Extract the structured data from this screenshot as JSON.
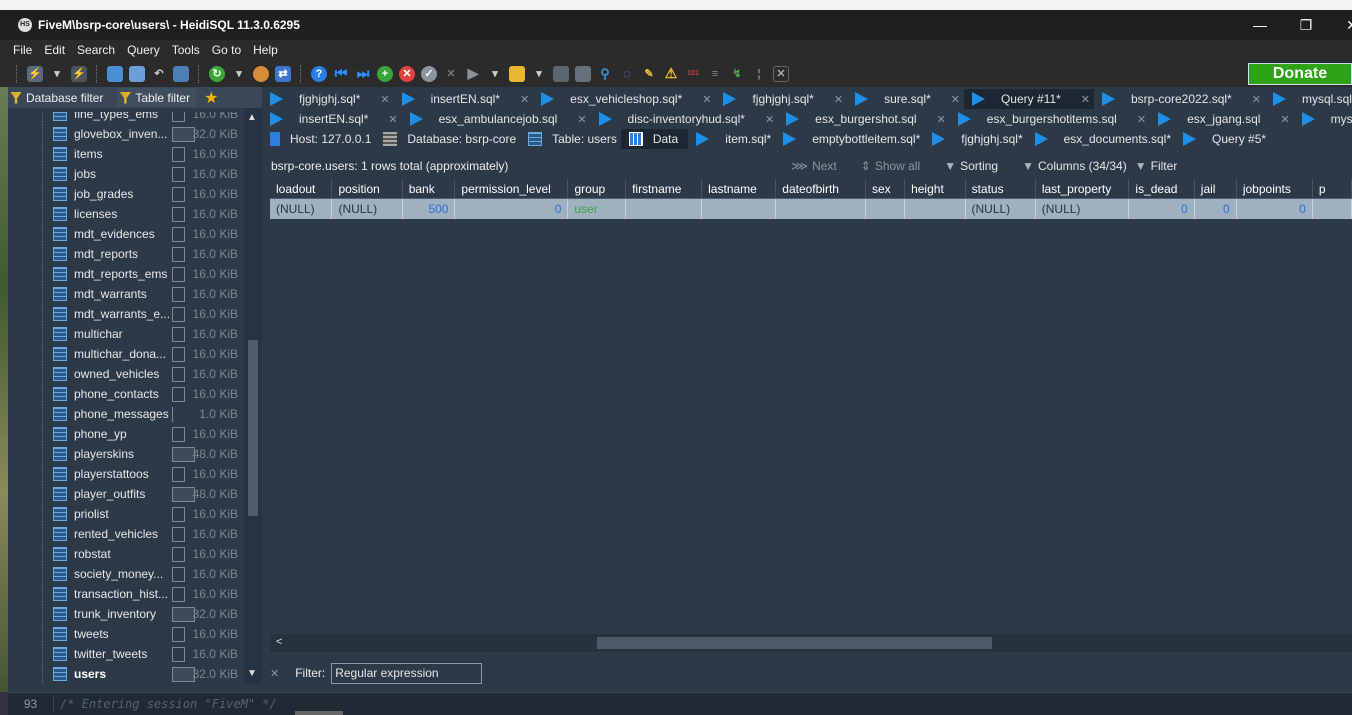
{
  "window": {
    "title": "FiveM\\bsrp-core\\users\\ - HeidiSQL 11.3.0.6295",
    "icon_label": "HS",
    "controls": [
      "—",
      "❐",
      "✕"
    ]
  },
  "menu": [
    "File",
    "Edit",
    "Search",
    "Query",
    "Tools",
    "Go to",
    "Help"
  ],
  "toolbar": {
    "donate_label": "Donate",
    "icons": [
      "connect-icon",
      "disconnect-icon",
      "copy-icon",
      "paste-icon",
      "undo-icon",
      "print-icon",
      "refresh-icon",
      "user-manager-icon",
      "sync-icon",
      "help-icon",
      "first-icon",
      "last-icon",
      "add-icon",
      "delete-icon",
      "ok-icon",
      "cancel-icon",
      "run-icon",
      "open-folder-icon",
      "save-icon",
      "save-as-icon",
      "find-icon",
      "replace-icon",
      "clean-icon",
      "warning-icon",
      "binary-icon",
      "wordwrap-icon",
      "format-icon",
      "close-icon"
    ]
  },
  "left_panel": {
    "database_filter_label": "Database filter",
    "table_filter_label": "Table filter",
    "tables": [
      {
        "name": "fine_types_ems",
        "size": "16.0 KiB",
        "bar": "normal"
      },
      {
        "name": "glovebox_inven...",
        "size": "32.0 KiB",
        "bar": "wide"
      },
      {
        "name": "items",
        "size": "16.0 KiB",
        "bar": "normal"
      },
      {
        "name": "jobs",
        "size": "16.0 KiB",
        "bar": "normal"
      },
      {
        "name": "job_grades",
        "size": "16.0 KiB",
        "bar": "normal"
      },
      {
        "name": "licenses",
        "size": "16.0 KiB",
        "bar": "normal"
      },
      {
        "name": "mdt_evidences",
        "size": "16.0 KiB",
        "bar": "normal"
      },
      {
        "name": "mdt_reports",
        "size": "16.0 KiB",
        "bar": "normal"
      },
      {
        "name": "mdt_reports_ems",
        "size": "16.0 KiB",
        "bar": "normal"
      },
      {
        "name": "mdt_warrants",
        "size": "16.0 KiB",
        "bar": "normal"
      },
      {
        "name": "mdt_warrants_e...",
        "size": "16.0 KiB",
        "bar": "normal"
      },
      {
        "name": "multichar",
        "size": "16.0 KiB",
        "bar": "normal"
      },
      {
        "name": "multichar_dona...",
        "size": "16.0 KiB",
        "bar": "normal"
      },
      {
        "name": "owned_vehicles",
        "size": "16.0 KiB",
        "bar": "normal"
      },
      {
        "name": "phone_contacts",
        "size": "16.0 KiB",
        "bar": "normal"
      },
      {
        "name": "phone_messages",
        "size": "1.0 KiB",
        "bar": "thin"
      },
      {
        "name": "phone_yp",
        "size": "16.0 KiB",
        "bar": "normal"
      },
      {
        "name": "playerskins",
        "size": "48.0 KiB",
        "bar": "wide"
      },
      {
        "name": "playerstattoos",
        "size": "16.0 KiB",
        "bar": "normal"
      },
      {
        "name": "player_outfits",
        "size": "48.0 KiB",
        "bar": "wide"
      },
      {
        "name": "priolist",
        "size": "16.0 KiB",
        "bar": "normal"
      },
      {
        "name": "rented_vehicles",
        "size": "16.0 KiB",
        "bar": "normal"
      },
      {
        "name": "robstat",
        "size": "16.0 KiB",
        "bar": "normal"
      },
      {
        "name": "society_money...",
        "size": "16.0 KiB",
        "bar": "normal"
      },
      {
        "name": "transaction_hist...",
        "size": "16.0 KiB",
        "bar": "normal"
      },
      {
        "name": "trunk_inventory",
        "size": "32.0 KiB",
        "bar": "wide"
      },
      {
        "name": "tweets",
        "size": "16.0 KiB",
        "bar": "normal"
      },
      {
        "name": "twitter_tweets",
        "size": "16.0 KiB",
        "bar": "normal"
      },
      {
        "name": "users",
        "size": "32.0 KiB",
        "bar": "wide",
        "selected": true
      }
    ]
  },
  "query_tabs_row1": [
    {
      "label": "fjghjghj.sql*",
      "active": false
    },
    {
      "label": "insertEN.sql*",
      "active": false
    },
    {
      "label": "esx_vehicleshop.sql*",
      "active": false
    },
    {
      "label": "fjghjghj.sql*",
      "active": false
    },
    {
      "label": "sure.sql*",
      "active": false
    },
    {
      "label": "Query #11*",
      "active": true
    },
    {
      "label": "bsrp-core2022.sql*",
      "active": false
    },
    {
      "label": "mysql.sql*",
      "active": false
    }
  ],
  "query_tabs_row2": [
    {
      "label": "insertEN.sql*"
    },
    {
      "label": "esx_ambulancejob.sql"
    },
    {
      "label": "disc-inventoryhud.sql*"
    },
    {
      "label": "esx_burgershot.sql"
    },
    {
      "label": "esx_burgershotitems.sql"
    },
    {
      "label": "esx_jgang.sql"
    },
    {
      "label": "mysql.sql*"
    }
  ],
  "tabs_row3": {
    "host": "Host: 127.0.0.1",
    "database": "Database: bsrp-core",
    "table": "Table: users",
    "data": "Data",
    "query_tabs": [
      {
        "label": "item.sql*"
      },
      {
        "label": "emptybottleitem.sql*"
      },
      {
        "label": "fjghjghj.sql*"
      },
      {
        "label": "esx_documents.sql*"
      },
      {
        "label": "Query #5*"
      }
    ]
  },
  "info_bar": {
    "summary": "bsrp-core.users: 1 rows total (approximately)",
    "next": "Next",
    "show_all": "Show all",
    "sorting": "Sorting",
    "columns": "Columns (34/34)",
    "filter": "Filter"
  },
  "grid": {
    "columns": [
      "loadout",
      "position",
      "bank",
      "permission_level",
      "group",
      "firstname",
      "lastname",
      "dateofbirth",
      "sex",
      "height",
      "status",
      "last_property",
      "is_dead",
      "jail",
      "jobpoints",
      "p"
    ],
    "rows": [
      [
        "(NULL)",
        "(NULL)",
        "500",
        "0",
        "user",
        "",
        "",
        "",
        "",
        "",
        "(NULL)",
        "(NULL)",
        "0",
        "0",
        "0",
        ""
      ]
    ]
  },
  "filter_bar": {
    "label": "Filter:",
    "value": "Regular expression"
  },
  "status_bar": {
    "line_number": "93",
    "log": "/* Entering session \"FiveM\" */"
  }
}
